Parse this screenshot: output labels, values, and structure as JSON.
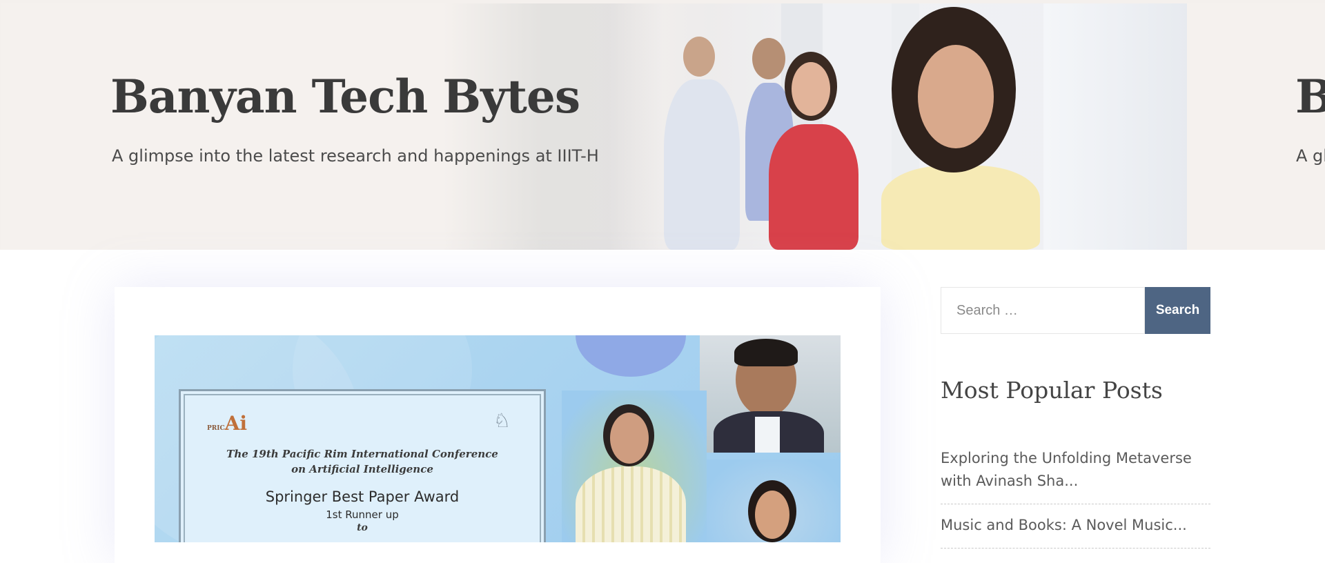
{
  "hero": {
    "title": "Banyan Tech Bytes",
    "subtitle": "A glimpse  into the latest research and happenings at IIIT-H",
    "next_title": "Banyan Tech Bytes",
    "next_subtitle": "A glimpse  into the latest research and happenings at IIIT-H"
  },
  "featured_image": {
    "logo_text": "Ai",
    "logo_prefix": "PRIC",
    "conference": "The 19th Pacific Rim International Conference on Artificial Intelligence",
    "award": "Springer Best Paper Award",
    "runner_up": "1st  Runner up",
    "to": "to"
  },
  "sidebar": {
    "search": {
      "placeholder": "Search …",
      "button_label": "Search"
    },
    "popular": {
      "title": "Most Popular Posts",
      "items": [
        "Exploring the Unfolding Metaverse with Avinash Sha...",
        "Music and Books: A Novel Music..."
      ]
    }
  },
  "colors": {
    "accent": "#4e6583",
    "hero_bg": "#f5f1ee",
    "title_text": "#3a3a3a"
  }
}
